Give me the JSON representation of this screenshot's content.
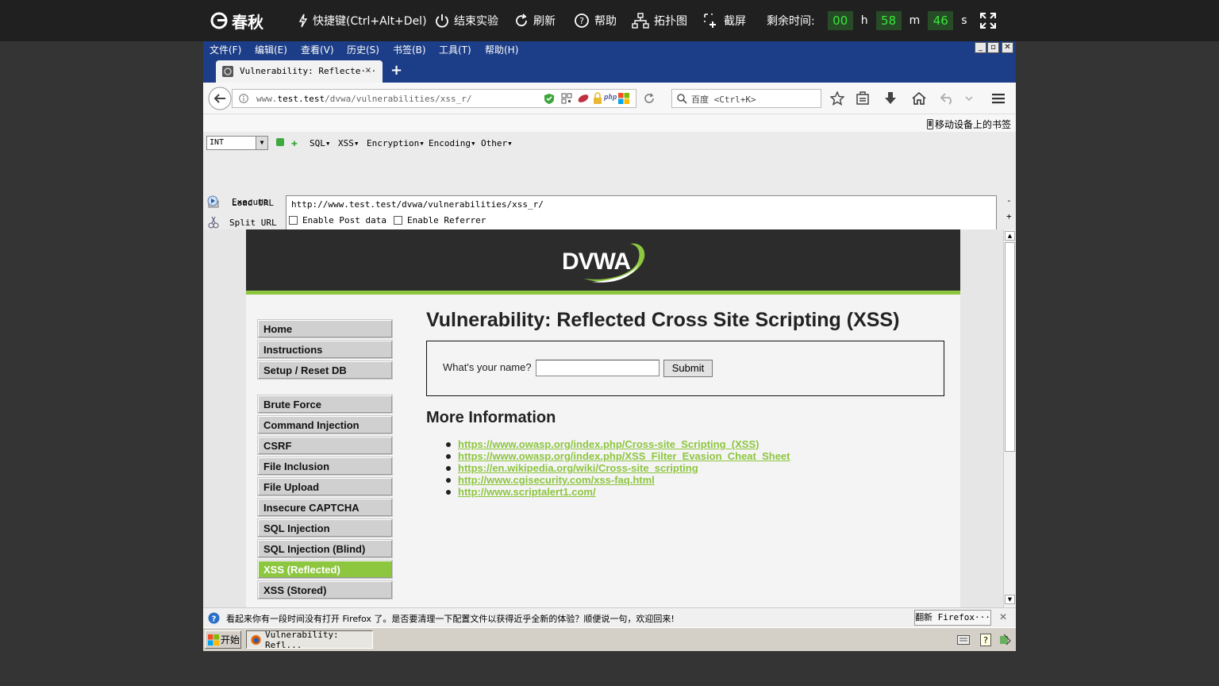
{
  "lab_toolbar": {
    "logo_text": "春秋",
    "shortcut_label": "快捷键(Ctrl+Alt+Del)",
    "end_label": "结束实验",
    "refresh_label": "刷新",
    "help_label": "帮助",
    "topology_label": "拓扑图",
    "screenshot_label": "截屏",
    "remaining_label": "剩余时间:",
    "hours": "00",
    "h_unit": "h",
    "minutes": "58",
    "m_unit": "m",
    "seconds": "46",
    "s_unit": "s"
  },
  "menu": {
    "file": "文件(F)",
    "edit": "编辑(E)",
    "view": "查看(V)",
    "history": "历史(S)",
    "bookmarks": "书签(B)",
    "tools": "工具(T)",
    "help": "帮助(H)"
  },
  "window_controls": {
    "minimize": "_",
    "restore": "▫",
    "close": "✕"
  },
  "tab": {
    "title": "Vulnerability: Reflecte···",
    "close": "✕",
    "new_tab": "+"
  },
  "nav": {
    "url_prefix": "www.",
    "url_domain": "test.test",
    "url_path": "/dvwa/vulnerabilities/xss_r/",
    "search_placeholder": "百度 <Ctrl+K>"
  },
  "bookmarks_bar": {
    "mobile_label": "移动设备上的书签"
  },
  "hackbar": {
    "select_value": "INT",
    "menus": [
      "SQL▾",
      "XSS▾",
      "Encryption▾",
      "Encoding▾",
      "Other▾"
    ],
    "load_url": "Load URL",
    "split_url": "Split URL",
    "execute": "Execute",
    "url_text": "http://www.test.test/dvwa/vulnerabilities/xss_r/",
    "enable_post": "Enable Post data",
    "enable_referrer": "Enable Referrer",
    "minus": "-",
    "plus": "+"
  },
  "dvwa": {
    "logo": "DVWA",
    "nav_group1": [
      "Home",
      "Instructions",
      "Setup / Reset DB"
    ],
    "nav_group2": [
      "Brute Force",
      "Command Injection",
      "CSRF",
      "File Inclusion",
      "File Upload",
      "Insecure CAPTCHA",
      "SQL Injection",
      "SQL Injection (Blind)",
      "XSS (Reflected)",
      "XSS (Stored)"
    ],
    "selected_item": "XSS (Reflected)",
    "page_title": "Vulnerability: Reflected Cross Site Scripting (XSS)",
    "form_label": "What's your name?",
    "name_value": "",
    "submit_label": "Submit",
    "more_info_title": "More Information",
    "links": [
      "https://www.owasp.org/index.php/Cross-site_Scripting_(XSS)",
      "https://www.owasp.org/index.php/XSS_Filter_Evasion_Cheat_Sheet",
      "https://en.wikipedia.org/wiki/Cross-site_scripting",
      "http://www.cgisecurity.com/xss-faq.html",
      "http://www.scriptalert1.com/"
    ]
  },
  "notification": {
    "text": "看起来你有一段时间没有打开 Firefox 了。是否要清理一下配置文件以获得近乎全新的体验？顺便说一句，欢迎回来!",
    "button": "翻新 Firefox···",
    "close": "✕"
  },
  "taskbar": {
    "start": "开始",
    "window_item": "Vulnerability: Refl..."
  },
  "colors": {
    "accent_green": "#8dc63f",
    "firefox_blue": "#1c3d87",
    "timer_green": "#39e83a"
  }
}
